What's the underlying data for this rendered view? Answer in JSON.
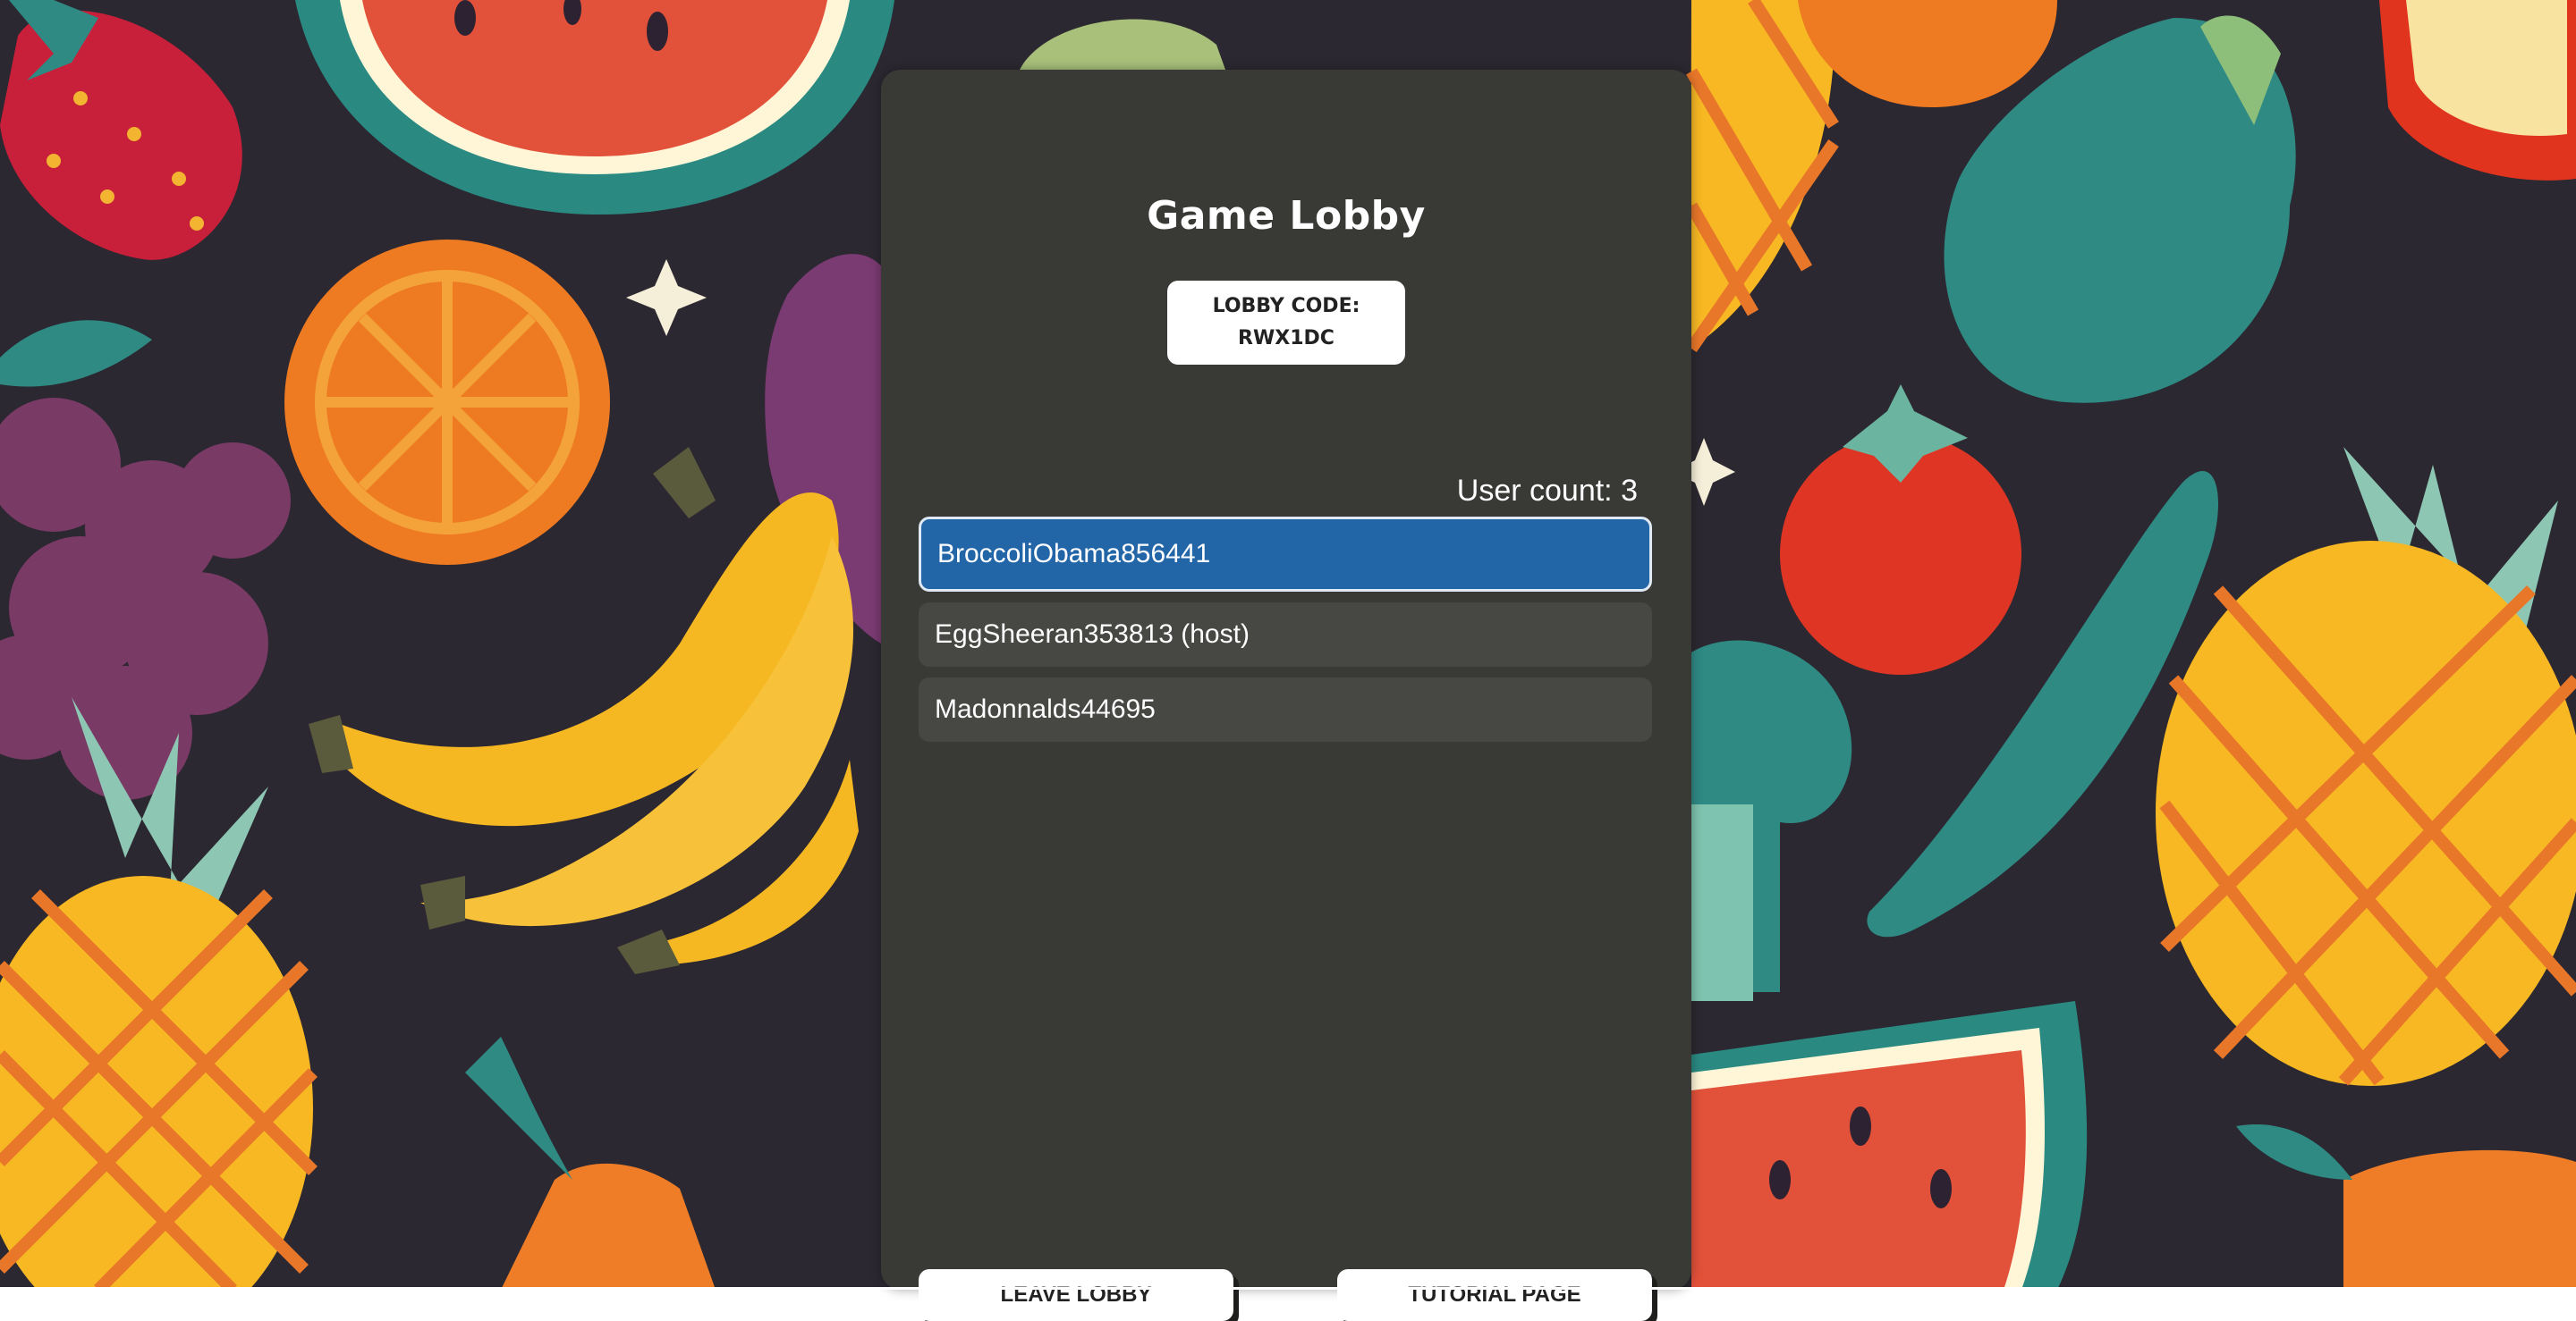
{
  "lobby": {
    "title": "Game Lobby",
    "code_label": "LOBBY CODE:",
    "code_value": "RWX1DC",
    "user_count_text": "User count: 3"
  },
  "players": [
    {
      "name": "BroccoliObama856441",
      "is_self": true
    },
    {
      "name": "EggSheeran353813 (host)",
      "is_self": false
    },
    {
      "name": "Madonnalds44695",
      "is_self": false
    }
  ],
  "buttons": {
    "leave_label": "LEAVE LOBBY",
    "tutorial_label": "TUTORIAL PAGE"
  },
  "colors": {
    "background": "#2c2831",
    "card": "#393936",
    "selected_player": "#2366a8",
    "player_row": "#474744"
  }
}
